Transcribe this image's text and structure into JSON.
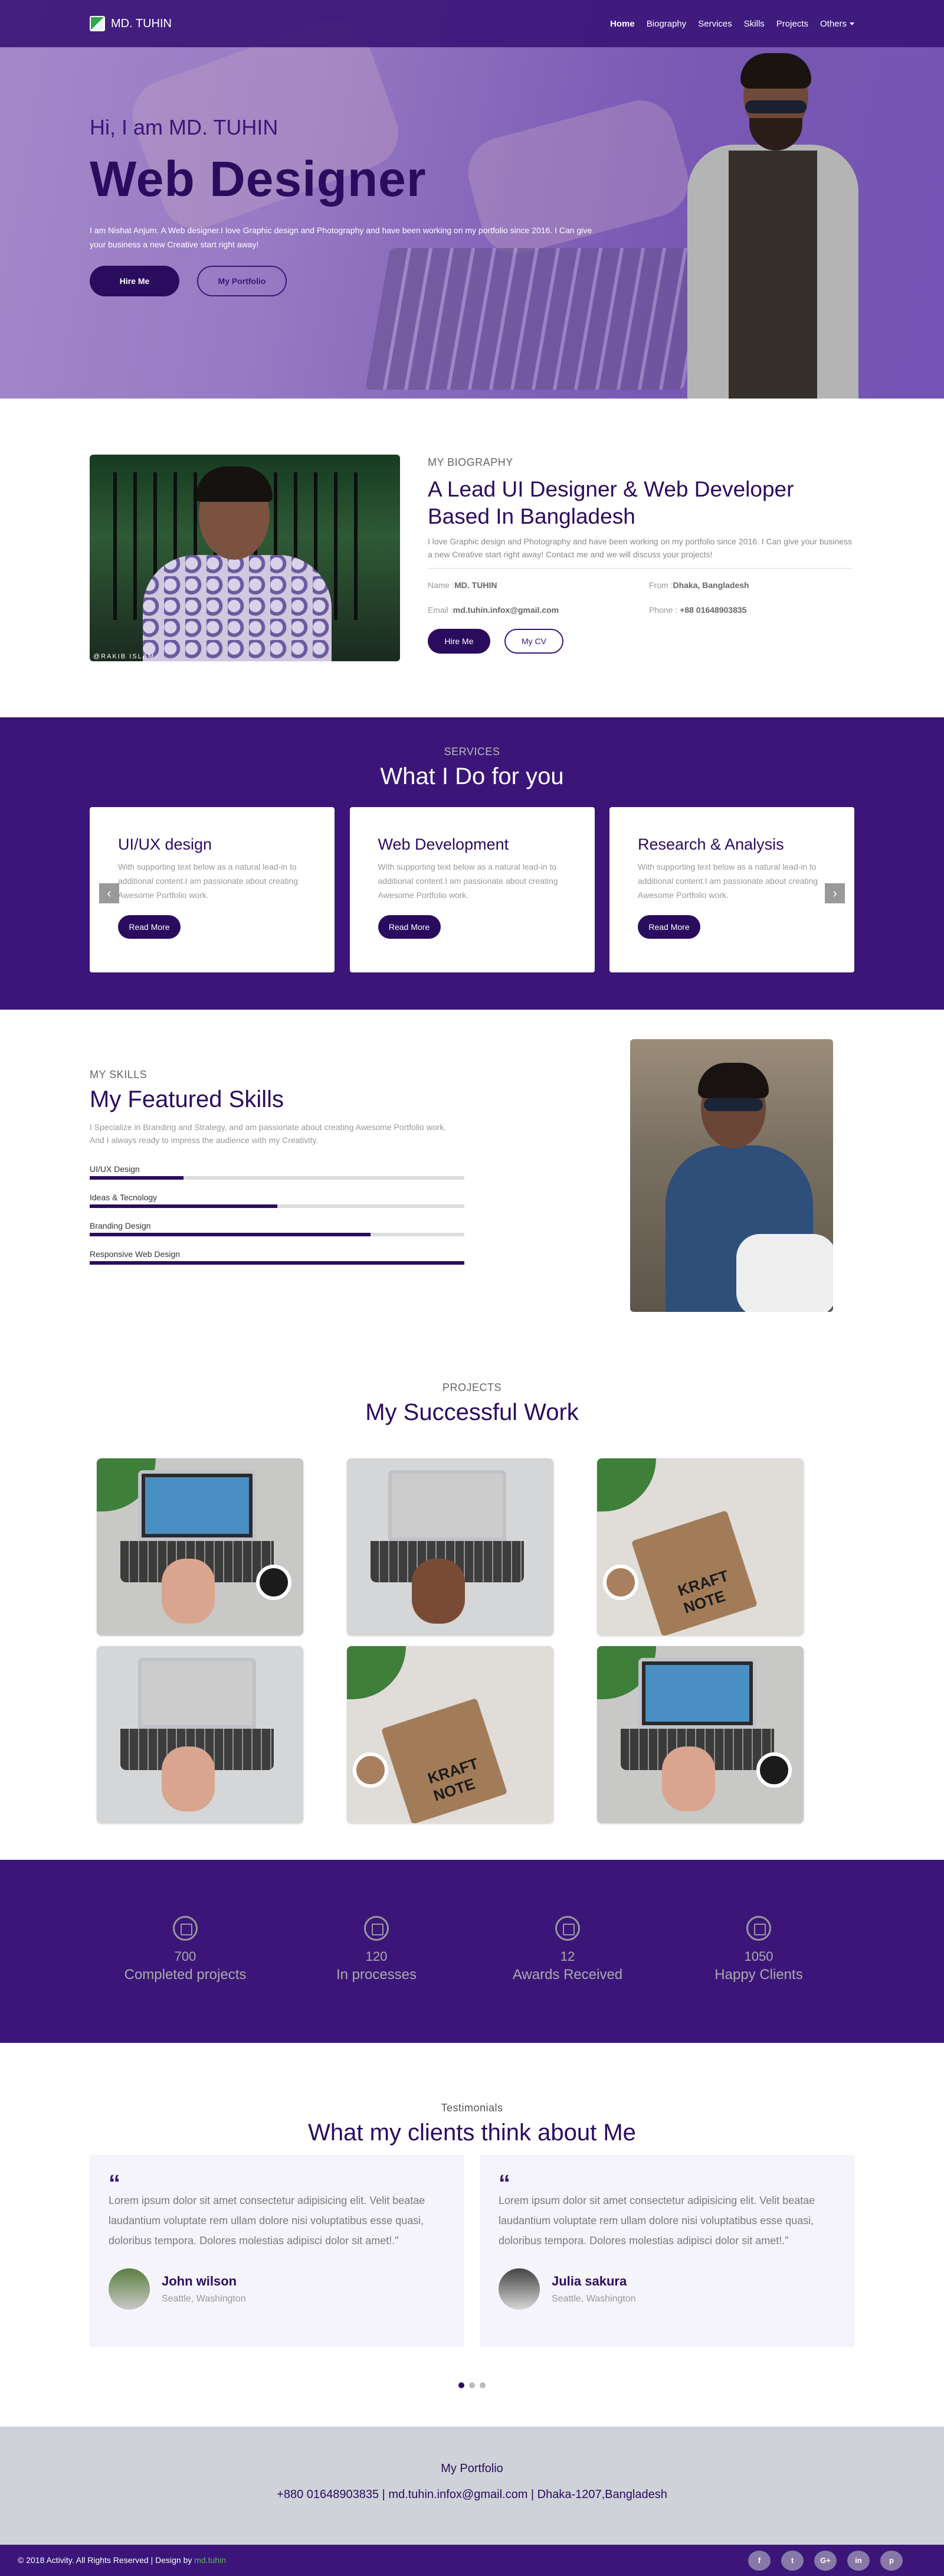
{
  "nav": {
    "brand": "MD. TUHIN",
    "items": [
      "Home",
      "Biography",
      "Services",
      "Skills",
      "Projects",
      "Others"
    ]
  },
  "hero": {
    "greeting": "Hi, I am MD. TUHIN",
    "title": "Web Designer",
    "desc": "I am Nishat Anjum. A Web designer.I love Graphic design and Photography and have been working on my portfolio since 2016. I Can give your business a new Creative start right away!",
    "hire": "Hire Me",
    "portfolio": "My Portfolio"
  },
  "bio": {
    "label": "MY BIOGRAPHY",
    "title": "A Lead UI Designer & Web Developer Based In Bangladesh",
    "desc": "I love Graphic design and Photography and have been working on my portfolio since 2016. I Can give your business a new Creative start right away! Contact me and we will discuss your projects!",
    "name_label": "Name :",
    "name": "MD. TUHIN",
    "from_label": "From :",
    "from": "Dhaka, Bangladesh",
    "email_label": "Email :",
    "email": "md.tuhin.infox@gmail.com",
    "phone_label": "Phone : ",
    "phone": "+88 01648903835",
    "hire": "Hire Me",
    "cv": "My CV",
    "photo_sig": "@RAKIB ISLAM"
  },
  "services": {
    "label": "SERVICES",
    "title": "What I Do for you",
    "cards": [
      {
        "title": "UI/UX design",
        "text": "With supporting text below as a natural lead-in to additional content.I am passionate about creating Awesome Portfolio work.",
        "btn": "Read More"
      },
      {
        "title": "Web Development",
        "text": "With supporting text below as a natural lead-in to additional content.I am passionate about creating Awesome Portfolio work.",
        "btn": "Read More"
      },
      {
        "title": "Research & Analysis",
        "text": "With supporting text below as a natural lead-in to additional content.I am passionate about creating Awesome Portfolio work.",
        "btn": "Read More"
      }
    ]
  },
  "skills": {
    "label": "MY SKILLS",
    "title": "My Featured Skills",
    "desc": "I Specialize in Branding and Strategy, and am passionate about creating Awesome Portfolio work. And I always ready to impress the audience with my Creativity.",
    "items": [
      {
        "name": "UI/UX Design",
        "level": 0.25
      },
      {
        "name": "Ideas & Tecnology",
        "level": 0.5
      },
      {
        "name": "Branding Design",
        "level": 0.75
      },
      {
        "name": "Responsive Web Design",
        "level": 1.0
      }
    ]
  },
  "projects": {
    "label": "PROJECTS",
    "title": "My Successful Work"
  },
  "stats": [
    {
      "num": "700",
      "text": "Completed projects"
    },
    {
      "num": "120",
      "text": "In processes"
    },
    {
      "num": "12",
      "text": "Awards Received"
    },
    {
      "num": "1050",
      "text": "Happy Clients"
    }
  ],
  "testimonials": {
    "label": "Testimonials",
    "title": "What my clients think about Me",
    "items": [
      {
        "quote": "Lorem ipsum dolor sit amet consectetur adipisicing elit. Velit beatae laudantium voluptate rem ullam dolore nisi voluptatibus esse quasi, doloribus tempora. Dolores molestias adipisci dolor sit amet!.\"",
        "name": "John wilson",
        "loc": "Seattle, Washington"
      },
      {
        "quote": "Lorem ipsum dolor sit amet consectetur adipisicing elit. Velit beatae laudantium voluptate rem ullam dolore nisi voluptatibus esse quasi, doloribus tempora. Dolores molestias adipisci dolor sit amet!.\"",
        "name": "Julia sakura",
        "loc": "Seattle, Washington"
      }
    ]
  },
  "footer": {
    "title": "My Portfolio",
    "contact": "+880 01648903835 | md.tuhin.infox@gmail.com | Dhaka-1207,Bangladesh",
    "copy": "© 2018 Activity. All Rights Reserved | Design by ",
    "designer": "md.tuhin",
    "social": [
      "f",
      "t",
      "G+",
      "in",
      "p"
    ]
  },
  "colors": {
    "primary": "#3b1678",
    "dark": "#2a0c5e"
  }
}
